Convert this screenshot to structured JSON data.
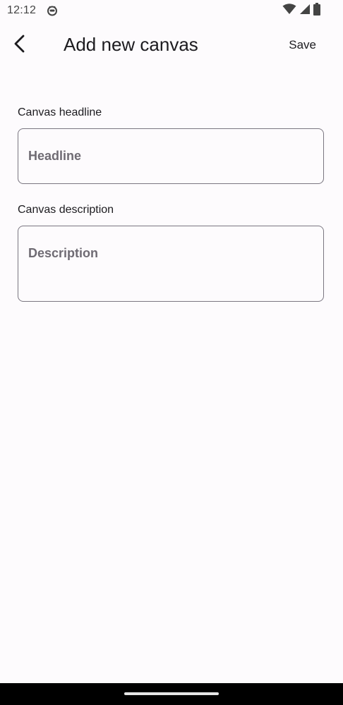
{
  "status_bar": {
    "time": "12:12",
    "app_icon": "cat-face-icon",
    "icons": [
      "wifi-icon",
      "signal-icon",
      "battery-icon"
    ]
  },
  "app_bar": {
    "back_icon": "chevron-left-icon",
    "title": "Add new canvas",
    "save_label": "Save"
  },
  "form": {
    "headline": {
      "label": "Canvas headline",
      "placeholder": "Headline",
      "value": ""
    },
    "description": {
      "label": "Canvas description",
      "placeholder": "Description",
      "value": ""
    }
  },
  "colors": {
    "background": "#fdfbfd",
    "text": "#1c1b1f",
    "outline": "#7a7680",
    "placeholder": "#6f6b73",
    "nav_bar": "#000000"
  }
}
